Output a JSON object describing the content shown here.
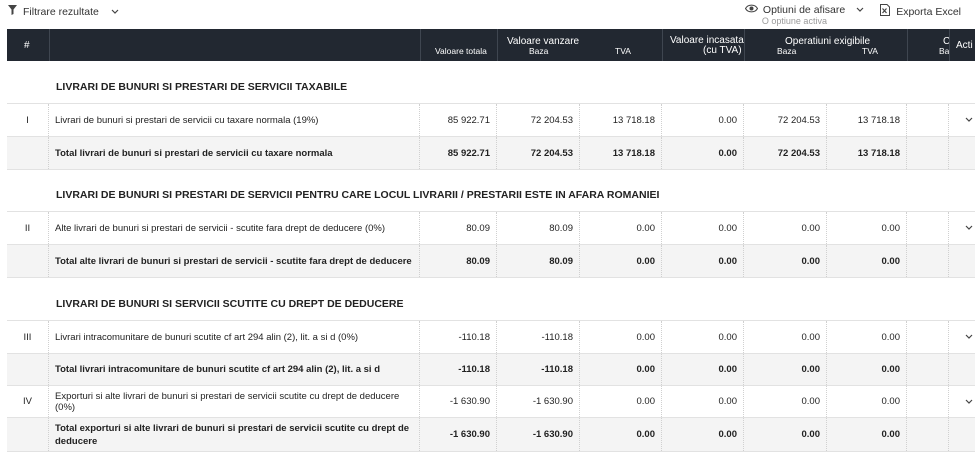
{
  "toolbar": {
    "filter_label": "Filtrare rezultate",
    "options_label": "Optiuni de afisare",
    "options_sub": "O optiune activa",
    "export_label": "Exporta Excel"
  },
  "header": {
    "index": "#",
    "valoare_totala": "Valoare totala",
    "valoare_vanzare": "Valoare vanzare",
    "baza": "Baza",
    "tva": "TVA",
    "valoare_incasata_1": "Valoare incasata",
    "valoare_incasata_2": "(cu TVA)",
    "operatiuni_exigibile": "Operatiuni exigibile",
    "baza2": "Baza",
    "tva2": "TVA",
    "partial_top": "C",
    "partial_bottom": "Ba",
    "actiuni_partial": "Acti"
  },
  "sections": [
    {
      "title": "LIVRARI DE BUNURI SI PRESTARI DE SERVICII TAXABILE",
      "row": {
        "index": "I",
        "label": "Livrari de bunuri si prestari de servicii cu taxare normala (19%)",
        "total": "85 922.71",
        "baza": "72 204.53",
        "tva": "13 718.18",
        "incasata": "0.00",
        "ex_baza": "72 204.53",
        "ex_tva": "13 718.18"
      },
      "total_row": {
        "label": "Total livrari de bunuri si prestari de servicii cu taxare normala",
        "total": "85 922.71",
        "baza": "72 204.53",
        "tva": "13 718.18",
        "incasata": "0.00",
        "ex_baza": "72 204.53",
        "ex_tva": "13 718.18"
      }
    },
    {
      "title": "LIVRARI DE BUNURI SI PRESTARI DE SERVICII PENTRU CARE LOCUL LIVRARII / PRESTARII ESTE IN AFARA ROMANIEI",
      "row": {
        "index": "II",
        "label": "Alte livrari de bunuri si prestari de servicii - scutite fara drept de deducere (0%)",
        "total": "80.09",
        "baza": "80.09",
        "tva": "0.00",
        "incasata": "0.00",
        "ex_baza": "0.00",
        "ex_tva": "0.00"
      },
      "total_row": {
        "label": "Total alte livrari de bunuri si prestari de servicii - scutite fara drept de deducere",
        "total": "80.09",
        "baza": "80.09",
        "tva": "0.00",
        "incasata": "0.00",
        "ex_baza": "0.00",
        "ex_tva": "0.00"
      }
    },
    {
      "title": "LIVRARI DE BUNURI SI SERVICII SCUTITE CU DREPT DE DEDUCERE",
      "row": {
        "index": "III",
        "label": "Livrari intracomunitare de bunuri scutite cf art 294 alin (2), lit. a si d (0%)",
        "total": "-110.18",
        "baza": "-110.18",
        "tva": "0.00",
        "incasata": "0.00",
        "ex_baza": "0.00",
        "ex_tva": "0.00"
      },
      "total_row": {
        "label": "Total livrari intracomunitare de bunuri scutite cf art 294 alin (2), lit. a si d",
        "total": "-110.18",
        "baza": "-110.18",
        "tva": "0.00",
        "incasata": "0.00",
        "ex_baza": "0.00",
        "ex_tva": "0.00"
      },
      "row2": {
        "index": "IV",
        "label": "Exporturi si alte livrari de bunuri si prestari de servicii scutite cu drept de deducere (0%)",
        "total": "-1 630.90",
        "baza": "-1 630.90",
        "tva": "0.00",
        "incasata": "0.00",
        "ex_baza": "0.00",
        "ex_tva": "0.00"
      },
      "total_row2": {
        "label": "Total exporturi si alte livrari de bunuri si prestari de servicii scutite cu drept de deducere",
        "total": "-1 630.90",
        "baza": "-1 630.90",
        "tva": "0.00",
        "incasata": "0.00",
        "ex_baza": "0.00",
        "ex_tva": "0.00"
      }
    }
  ],
  "icons": {
    "filter": "filter-icon",
    "eye": "eye-icon",
    "excel": "excel-icon",
    "chevron": "chevron-down-icon"
  }
}
